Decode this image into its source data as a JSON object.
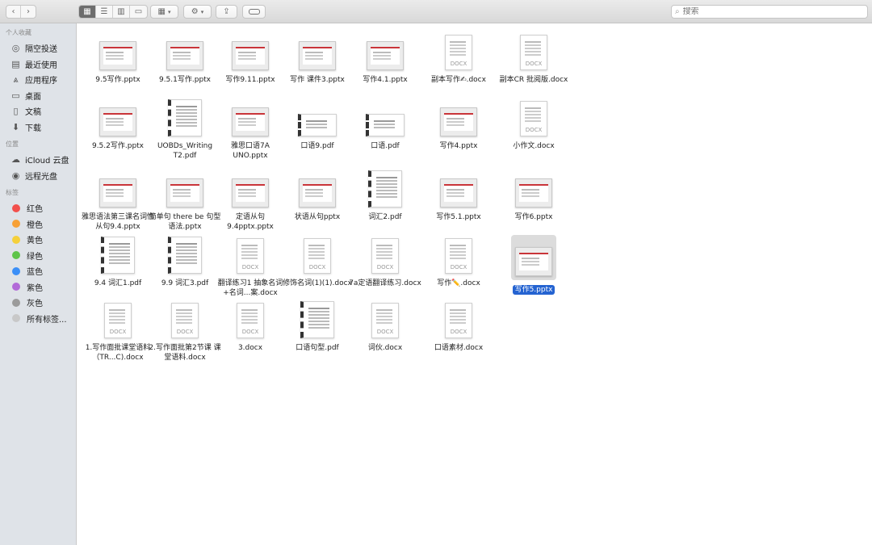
{
  "toolbar": {
    "view_modes": [
      "icon-view",
      "list-view",
      "column-view",
      "gallery-view"
    ],
    "search_placeholder": "搜索"
  },
  "sidebar": {
    "favorites_title": "个人收藏",
    "favorites": [
      {
        "label": "隔空投送",
        "icon": "airdrop-icon"
      },
      {
        "label": "最近使用",
        "icon": "recents-icon"
      },
      {
        "label": "应用程序",
        "icon": "applications-icon"
      },
      {
        "label": "桌面",
        "icon": "desktop-icon"
      },
      {
        "label": "文稿",
        "icon": "documents-icon"
      },
      {
        "label": "下载",
        "icon": "downloads-icon"
      }
    ],
    "locations_title": "位置",
    "locations": [
      {
        "label": "iCloud 云盘",
        "icon": "icloud-icon"
      },
      {
        "label": "远程光盘",
        "icon": "remote-disc-icon"
      }
    ],
    "tags_title": "标签",
    "tags": [
      {
        "label": "红色",
        "color": "#f2504c"
      },
      {
        "label": "橙色",
        "color": "#f7a035"
      },
      {
        "label": "黄色",
        "color": "#f5d03b"
      },
      {
        "label": "绿色",
        "color": "#5ec44a"
      },
      {
        "label": "蓝色",
        "color": "#3b8ff7"
      },
      {
        "label": "紫色",
        "color": "#b26ad8"
      },
      {
        "label": "灰色",
        "color": "#9b9b9b"
      },
      {
        "label": "所有标签...",
        "color": "#c8c8c8"
      }
    ]
  },
  "files": [
    {
      "name": "9.5写作.pptx",
      "kind": "pptx"
    },
    {
      "name": "9.5.1写作.pptx",
      "kind": "pptx"
    },
    {
      "name": "写作9.11.pptx",
      "kind": "pptx"
    },
    {
      "name": "写作 课件3.pptx",
      "kind": "pptx"
    },
    {
      "name": "写作4.1.pptx",
      "kind": "pptx"
    },
    {
      "name": "副本写作✍.docx",
      "kind": "docx",
      "tag": "DOCX"
    },
    {
      "name": "副本CR 批阅版.docx",
      "kind": "docx",
      "tag": "DOCX"
    },
    {
      "name": "9.5.2写作.pptx",
      "kind": "pptx"
    },
    {
      "name": "UOBDs_Writing T2.pdf",
      "kind": "pdf"
    },
    {
      "name": "雅思口语7A UNO.pptx",
      "kind": "pptx"
    },
    {
      "name": "口语9.pdf",
      "kind": "pdf-wide"
    },
    {
      "name": "口语.pdf",
      "kind": "pdf-wide"
    },
    {
      "name": "写作4.pptx",
      "kind": "pptx"
    },
    {
      "name": "小作文.docx",
      "kind": "docx",
      "tag": "DOCX"
    },
    {
      "name": "雅思语法第三课名词性从句9.4.pptx",
      "kind": "pptx"
    },
    {
      "name": "简单句 there be 句型 语法.pptx",
      "kind": "pptx"
    },
    {
      "name": "定语从句9.4pptx.pptx",
      "kind": "pptx"
    },
    {
      "name": "状语从句pptx",
      "kind": "pptx"
    },
    {
      "name": "词汇2.pdf",
      "kind": "pdf"
    },
    {
      "name": "写作5.1.pptx",
      "kind": "pptx"
    },
    {
      "name": "写作6.pptx",
      "kind": "pptx"
    },
    {
      "name": "9.4 词汇1.pdf",
      "kind": "pdf"
    },
    {
      "name": "9.9 词汇3.pdf",
      "kind": "pdf"
    },
    {
      "name": "翻译练习1 抽象名词+名词...案.docx",
      "kind": "docx",
      "tag": "DOCX"
    },
    {
      "name": "修饰名词(1)(1).docx",
      "kind": "docx",
      "tag": "DOCX"
    },
    {
      "name": "7a定语翻译练习.docx",
      "kind": "docx",
      "tag": "DOCX"
    },
    {
      "name": "写作✏️.docx",
      "kind": "docx",
      "tag": "DOCX"
    },
    {
      "name": "写作5.pptx",
      "kind": "pptx",
      "selected": true
    },
    {
      "name": "1.写作面批课堂语料（TR...C).docx",
      "kind": "docx",
      "tag": "DOCX"
    },
    {
      "name": "2.写作面批第2节课 课堂语料.docx",
      "kind": "docx",
      "tag": "DOCX"
    },
    {
      "name": "3.docx",
      "kind": "docx",
      "tag": "DOCX"
    },
    {
      "name": "口语句型.pdf",
      "kind": "pdf"
    },
    {
      "name": "词伙.docx",
      "kind": "docx",
      "tag": "DOCX"
    },
    {
      "name": "口语素材.docx",
      "kind": "docx",
      "tag": "DOCX"
    }
  ]
}
